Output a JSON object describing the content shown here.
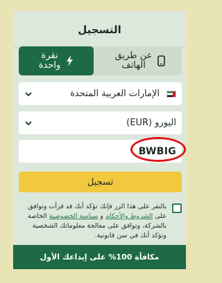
{
  "title": "التسجيل",
  "tabs": {
    "phone_label": "عن طريق\nالهاتف",
    "phone_icon": "phone-icon",
    "quick_label": "نقرة\nواحدة",
    "quick_icon": "lightning-icon"
  },
  "country": {
    "value": "الإمارات العربية المتحدة",
    "flag_icon": "uae-flag-icon"
  },
  "currency": {
    "value": "اليورو (EUR)"
  },
  "promo": {
    "value": "BWBIG"
  },
  "register_button": {
    "label": "تسجيل"
  },
  "consent": {
    "part1": "بالنقر على هذا الزر فإنك تؤكد أنك قد قرأت وتوافق على ",
    "terms_link": "الشروط والأحكام",
    "part2": " و ",
    "privacy_link": "سياسة الخصوصية",
    "part3": " الخاصة بالشركة، وتوافق على معالجة معلوماتك الشخصية وتؤكد أنك في سن قانونية."
  },
  "bonus_banner": {
    "text": "مكافأة 100% على إيداعك الأول"
  },
  "colors": {
    "accent": "#1e6a45",
    "button": "#f1c93f",
    "highlight": "#e0141a"
  }
}
